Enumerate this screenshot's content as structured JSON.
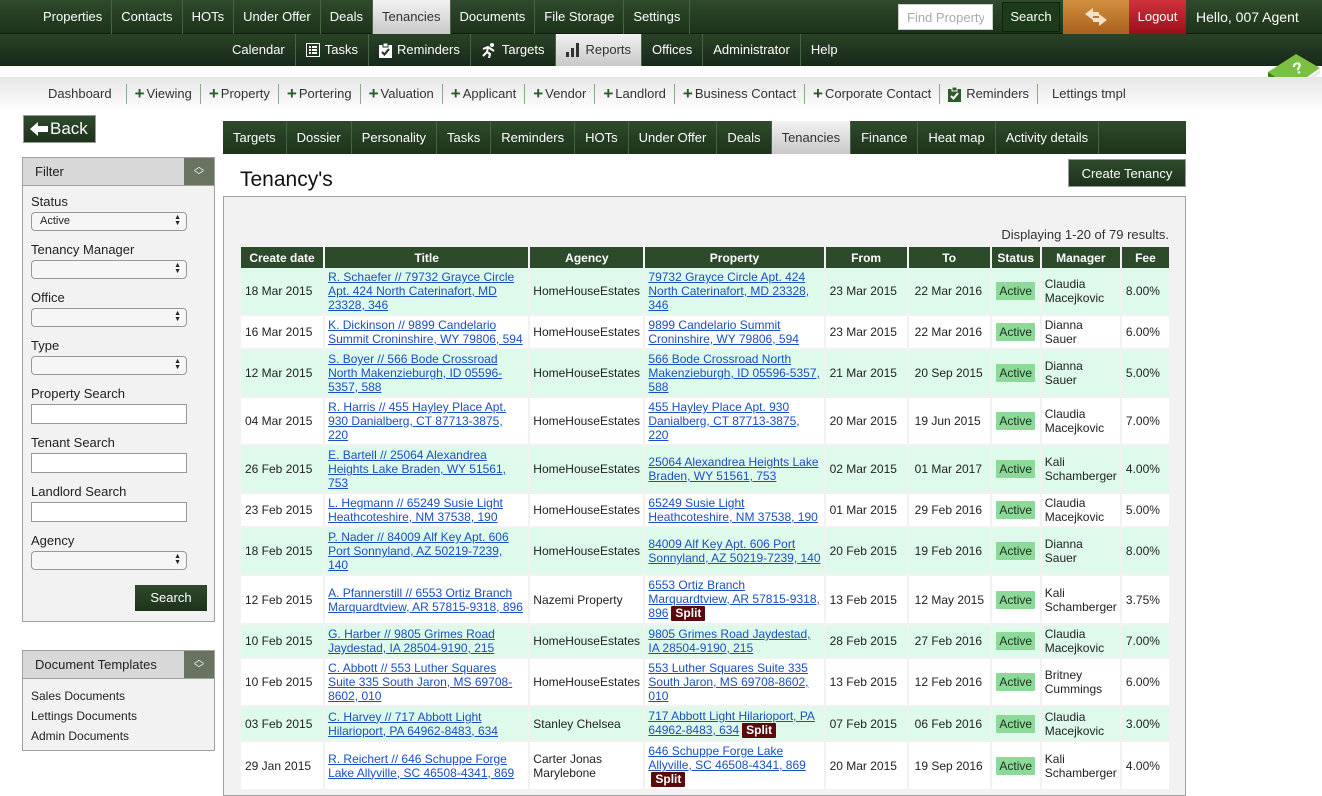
{
  "top_nav": {
    "items": [
      "Properties",
      "Contacts",
      "HOTs",
      "Under Offer",
      "Deals",
      "Tenancies",
      "Documents",
      "File Storage",
      "Settings"
    ],
    "active": "Tenancies",
    "find_placeholder": "Find Property",
    "search_label": "Search",
    "switch_icon": "swap-arrows-icon",
    "logout_label": "Logout",
    "greeting": "Hello, 007 Agent"
  },
  "sub_nav": {
    "items": [
      {
        "label": "Calendar",
        "icon": ""
      },
      {
        "label": "Tasks",
        "icon": "tasks-icon"
      },
      {
        "label": "Reminders",
        "icon": "clipboard-check-icon"
      },
      {
        "label": "Targets",
        "icon": "runner-icon"
      },
      {
        "label": "Reports",
        "icon": "bar-chart-icon"
      },
      {
        "label": "Offices",
        "icon": ""
      },
      {
        "label": "Administrator",
        "icon": ""
      },
      {
        "label": "Help",
        "icon": ""
      }
    ],
    "active": "Reports"
  },
  "quick_bar": {
    "items": [
      {
        "label": "Dashboard",
        "icon": ""
      },
      {
        "label": "Viewing",
        "icon": "plus"
      },
      {
        "label": "Property",
        "icon": "plus"
      },
      {
        "label": "Portering",
        "icon": "plus"
      },
      {
        "label": "Valuation",
        "icon": "plus"
      },
      {
        "label": "Applicant",
        "icon": "plus"
      },
      {
        "label": "Vendor",
        "icon": "plus"
      },
      {
        "label": "Landlord",
        "icon": "plus"
      },
      {
        "label": "Business Contact",
        "icon": "plus"
      },
      {
        "label": "Corporate Contact",
        "icon": "plus"
      },
      {
        "label": "Reminders",
        "icon": "clipboard"
      },
      {
        "label": "Lettings tmpl",
        "icon": ""
      }
    ]
  },
  "back_label": "Back",
  "filter": {
    "title": "Filter",
    "status_label": "Status",
    "status_value": "Active",
    "tenancy_manager_label": "Tenancy Manager",
    "tenancy_manager_value": "",
    "office_label": "Office",
    "office_value": "",
    "type_label": "Type",
    "type_value": "",
    "property_search_label": "Property Search",
    "property_search_value": "",
    "tenant_search_label": "Tenant Search",
    "tenant_search_value": "",
    "landlord_search_label": "Landlord Search",
    "landlord_search_value": "",
    "agency_label": "Agency",
    "agency_value": "",
    "search_label": "Search"
  },
  "document_templates": {
    "title": "Document Templates",
    "items": [
      "Sales Documents",
      "Lettings Documents",
      "Admin Documents"
    ]
  },
  "tabs": {
    "items": [
      "Targets",
      "Dossier",
      "Personality",
      "Tasks",
      "Reminders",
      "HOTs",
      "Under Offer",
      "Deals",
      "Tenancies",
      "Finance",
      "Heat map",
      "Activity details"
    ],
    "active": "Tenancies"
  },
  "page_title": "Tenancy's",
  "create_label": "Create Tenancy",
  "summary": "Displaying 1-20 of 79 results.",
  "table": {
    "columns": [
      "Create date",
      "Title",
      "Agency",
      "Property",
      "From",
      "To",
      "Status",
      "Manager",
      "Fee"
    ],
    "rows": [
      {
        "date": "18 Mar 2015",
        "title": "R. Schaefer // 79732 Grayce Circle Apt. 424 North Caterinafort, MD 23328, 346",
        "agency": "HomeHouseEstates",
        "property": "79732 Grayce Circle Apt. 424 North Caterinafort, MD 23328, 346",
        "split": false,
        "from": "23 Mar 2015",
        "to": "22 Mar 2016",
        "status": "Active",
        "manager": "Claudia Macejkovic",
        "fee": "8.00%"
      },
      {
        "date": "16 Mar 2015",
        "title": "K. Dickinson // 9899 Candelario Summit Croninshire, WY 79806, 594",
        "agency": "HomeHouseEstates",
        "property": "9899 Candelario Summit Croninshire, WY 79806, 594",
        "split": false,
        "from": "23 Mar 2015",
        "to": "22 Mar 2016",
        "status": "Active",
        "manager": "Dianna Sauer",
        "fee": "6.00%"
      },
      {
        "date": "12 Mar 2015",
        "title": "S. Boyer // 566 Bode Crossroad North Makenzieburgh, ID 05596-5357, 588",
        "agency": "HomeHouseEstates",
        "property": "566 Bode Crossroad North Makenzieburgh, ID 05596-5357, 588",
        "split": false,
        "from": "21 Mar 2015",
        "to": "20 Sep 2015",
        "status": "Active",
        "manager": "Dianna Sauer",
        "fee": "5.00%"
      },
      {
        "date": "04 Mar 2015",
        "title": "R. Harris // 455 Hayley Place Apt. 930 Danialberg, CT 87713-3875, 220",
        "agency": "HomeHouseEstates",
        "property": "455 Hayley Place Apt. 930 Danialberg, CT 87713-3875, 220",
        "split": false,
        "from": "20 Mar 2015",
        "to": "19 Jun 2015",
        "status": "Active",
        "manager": "Claudia Macejkovic",
        "fee": "7.00%"
      },
      {
        "date": "26 Feb 2015",
        "title": "E. Bartell // 25064 Alexandrea Heights Lake Braden, WY 51561, 753",
        "agency": "HomeHouseEstates",
        "property": "25064 Alexandrea Heights Lake Braden, WY 51561, 753",
        "split": false,
        "from": "02 Mar 2015",
        "to": "01 Mar 2017",
        "status": "Active",
        "manager": "Kali Schamberger",
        "fee": "4.00%"
      },
      {
        "date": "23 Feb 2015",
        "title": "L. Hegmann // 65249 Susie Light Heathcoteshire, NM 37538, 190",
        "agency": "HomeHouseEstates",
        "property": "65249 Susie Light Heathcoteshire, NM 37538, 190",
        "split": false,
        "from": "01 Mar 2015",
        "to": "29 Feb 2016",
        "status": "Active",
        "manager": "Claudia Macejkovic",
        "fee": "5.00%"
      },
      {
        "date": "18 Feb 2015",
        "title": "P. Nader // 84009 Alf Key Apt. 606 Port Sonnyland, AZ 50219-7239, 140",
        "agency": "HomeHouseEstates",
        "property": "84009 Alf Key Apt. 606 Port Sonnyland, AZ 50219-7239, 140",
        "split": false,
        "from": "20 Feb 2015",
        "to": "19 Feb 2016",
        "status": "Active",
        "manager": "Dianna Sauer",
        "fee": "8.00%"
      },
      {
        "date": "12 Feb 2015",
        "title": "A. Pfannerstill // 6553 Ortiz Branch Marquardtview, AR 57815-9318, 896",
        "agency": "Nazemi Property",
        "property": "6553 Ortiz Branch Marquardtview, AR 57815-9318, 896",
        "split": true,
        "from": "13 Feb 2015",
        "to": "12 May 2015",
        "status": "Active",
        "manager": "Kali Schamberger",
        "fee": "3.75%"
      },
      {
        "date": "10 Feb 2015",
        "title": "G. Harber // 9805 Grimes Road Jaydestad, IA 28504-9190, 215",
        "agency": "HomeHouseEstates",
        "property": "9805 Grimes Road Jaydestad, IA 28504-9190, 215",
        "split": false,
        "from": "28 Feb 2015",
        "to": "27 Feb 2016",
        "status": "Active",
        "manager": "Claudia Macejkovic",
        "fee": "7.00%"
      },
      {
        "date": "10 Feb 2015",
        "title": "C. Abbott // 553 Luther Squares Suite 335 South Jaron, MS 69708-8602, 010",
        "agency": "HomeHouseEstates",
        "property": "553 Luther Squares Suite 335 South Jaron, MS 69708-8602, 010",
        "split": false,
        "from": "13 Feb 2015",
        "to": "12 Feb 2016",
        "status": "Active",
        "manager": "Britney Cummings",
        "fee": "6.00%"
      },
      {
        "date": "03 Feb 2015",
        "title": "C. Harvey // 717 Abbott Light Hilarioport, PA 64962-8483, 634",
        "agency": "Stanley Chelsea",
        "property": "717 Abbott Light Hilarioport, PA 64962-8483, 634",
        "split": true,
        "from": "07 Feb 2015",
        "to": "06 Feb 2016",
        "status": "Active",
        "manager": "Claudia Macejkovic",
        "fee": "3.00%"
      },
      {
        "date": "29 Jan 2015",
        "title": "R. Reichert // 646 Schuppe Forge Lake Allyville, SC 46508-4341, 869",
        "agency": "Carter Jonas Marylebone",
        "property": "646 Schuppe Forge Lake Allyville, SC 46508-4341, 869",
        "split": true,
        "from": "20 Mar 2015",
        "to": "19 Sep 2016",
        "status": "Active",
        "manager": "Kali Schamberger",
        "fee": "4.00%"
      }
    ],
    "split_label": "Split"
  },
  "colors": {
    "brand_green": "#2d4a2a",
    "row_highlight": "#defaea",
    "active_badge": "#8dd99a",
    "split_badge": "#5a0a0a",
    "logout": "#c0202c",
    "switch": "#c07a30"
  }
}
